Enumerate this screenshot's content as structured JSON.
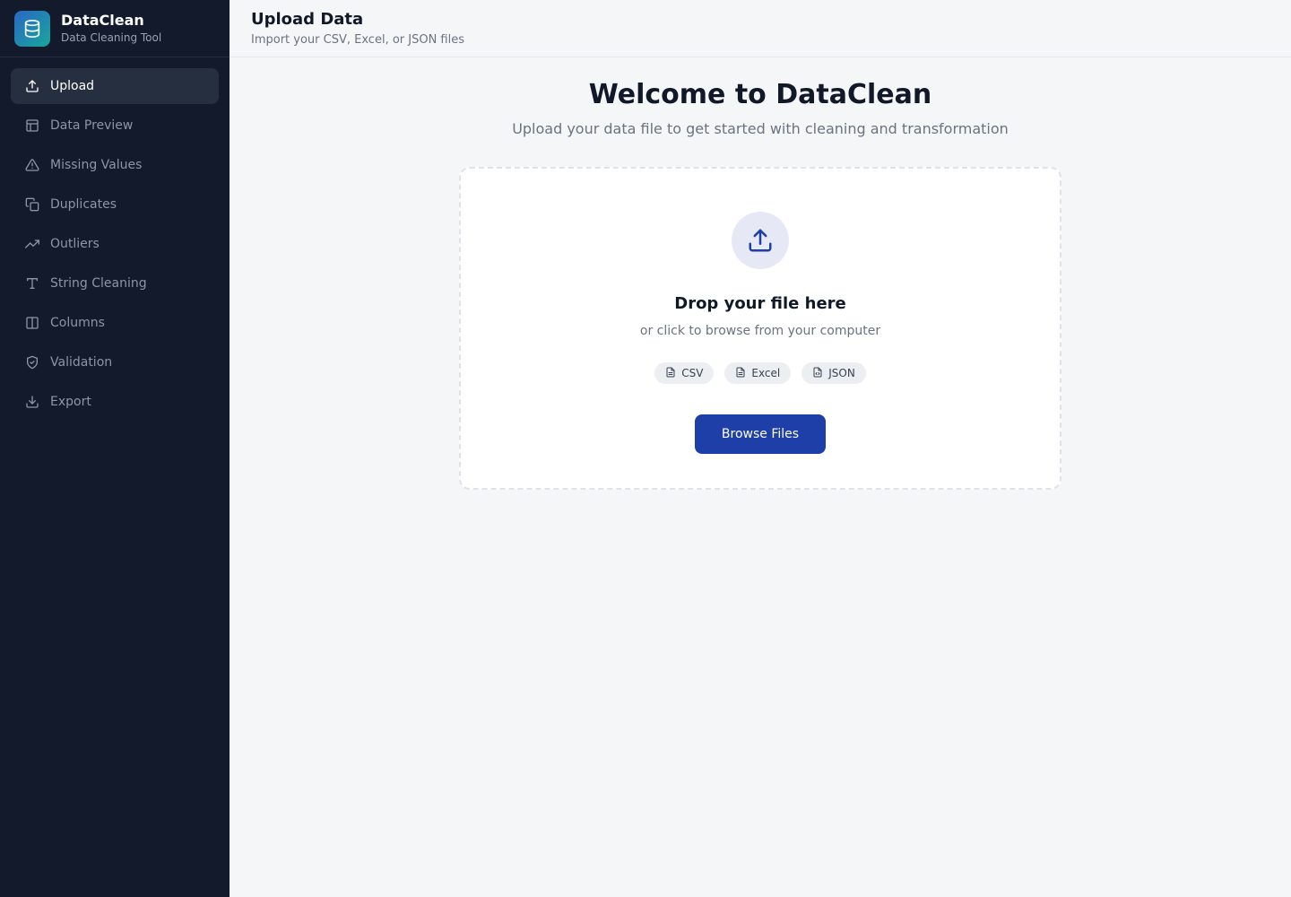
{
  "brand": {
    "name": "DataClean",
    "subtitle": "Data Cleaning Tool",
    "logo_icon": "database-icon"
  },
  "sidebar": {
    "items": [
      {
        "label": "Upload",
        "icon": "upload-icon",
        "active": true
      },
      {
        "label": "Data Preview",
        "icon": "table-icon",
        "active": false
      },
      {
        "label": "Missing Values",
        "icon": "warning-triangle-icon",
        "active": false
      },
      {
        "label": "Duplicates",
        "icon": "copy-icon",
        "active": false
      },
      {
        "label": "Outliers",
        "icon": "trending-up-icon",
        "active": false
      },
      {
        "label": "String Cleaning",
        "icon": "type-icon",
        "active": false
      },
      {
        "label": "Columns",
        "icon": "columns-icon",
        "active": false
      },
      {
        "label": "Validation",
        "icon": "shield-check-icon",
        "active": false
      },
      {
        "label": "Export",
        "icon": "download-icon",
        "active": false
      }
    ]
  },
  "header": {
    "title": "Upload Data",
    "subtitle": "Import your CSV, Excel, or JSON files"
  },
  "main": {
    "welcome_title": "Welcome to DataClean",
    "welcome_subtitle": "Upload your data file to get started with cleaning and transformation",
    "dropzone": {
      "title": "Drop your file here",
      "subtitle": "or click to browse from your computer",
      "formats": [
        "CSV",
        "Excel",
        "JSON"
      ],
      "button_label": "Browse Files"
    }
  },
  "colors": {
    "sidebar_bg": "#121a2b",
    "active_item_bg": "#262f40",
    "accent": "#1f3fa8",
    "page_bg": "#f5f6f8"
  }
}
